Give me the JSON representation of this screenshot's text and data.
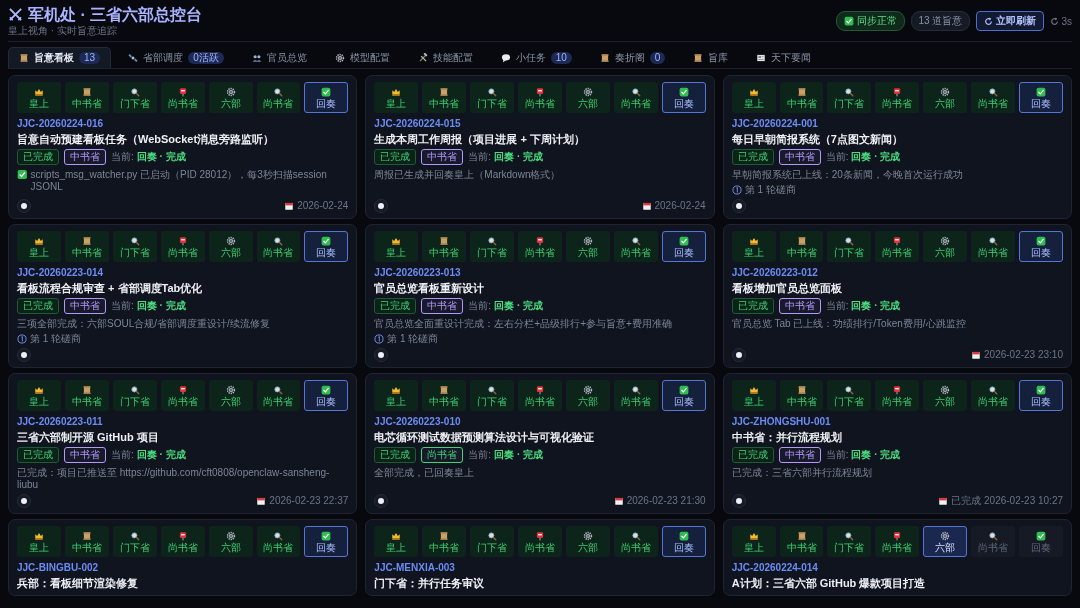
{
  "header": {
    "title": "军机处 · 三省六部总控台",
    "subtitle": "皇上视角 · 实时旨意追踪",
    "sync": "同步正常",
    "count": "13 道旨意",
    "refresh": "立即刷新",
    "interval": "3s"
  },
  "tabs": [
    {
      "label": "旨意看板",
      "count": "13",
      "selected": true
    },
    {
      "label": "省部调度",
      "count": "0活跃",
      "selected": false
    },
    {
      "label": "官员总览",
      "selected": false
    },
    {
      "label": "模型配置",
      "selected": false
    },
    {
      "label": "技能配置",
      "selected": false
    },
    {
      "label": "小任务",
      "count": "10",
      "selected": false
    },
    {
      "label": "奏折阁",
      "count": "0",
      "selected": false
    },
    {
      "label": "旨库",
      "selected": false
    },
    {
      "label": "天下要闻",
      "selected": false
    }
  ],
  "cards": [
    {
      "stages": [
        {
          "label": "皇上",
          "done": true,
          "selected": false
        },
        {
          "label": "中书省",
          "done": true,
          "selected": false
        },
        {
          "label": "门下省",
          "done": true,
          "selected": false
        },
        {
          "label": "尚书省",
          "done": true,
          "selected": false
        },
        {
          "label": "六部",
          "done": true,
          "selected": false
        },
        {
          "label": "尚书省",
          "done": true,
          "selected": false
        },
        {
          "label": "回奏",
          "done": true,
          "selected": true
        }
      ],
      "id": "JJC-20260224-016",
      "title": "旨意自动预建看板任务（WebSocket消息旁路监听）",
      "status": "已完成",
      "dept": "中书省",
      "color": "#b597ff",
      "current_label": "当前:",
      "current": "回奏 · 完成",
      "note": "scripts_msg_watcher.py 已启动（PID 28012），每3秒扫描session JSONL",
      "note_check": true,
      "date": "2026-02-24"
    },
    {
      "stages": [
        {
          "label": "皇上",
          "done": true,
          "selected": false
        },
        {
          "label": "中书省",
          "done": true,
          "selected": false
        },
        {
          "label": "门下省",
          "done": true,
          "selected": false
        },
        {
          "label": "尚书省",
          "done": true,
          "selected": false
        },
        {
          "label": "六部",
          "done": true,
          "selected": false
        },
        {
          "label": "尚书省",
          "done": true,
          "selected": false
        },
        {
          "label": "回奏",
          "done": true,
          "selected": true
        }
      ],
      "id": "JJC-20260224-015",
      "title": "生成本周工作周报（项目进展 + 下周计划）",
      "status": "已完成",
      "dept": "中书省",
      "color": "#b597ff",
      "current_label": "当前:",
      "current": "回奏 · 完成",
      "note": "周报已生成并回奏皇上（Markdown格式）",
      "date": "2026-02-24"
    },
    {
      "stages": [
        {
          "label": "皇上",
          "done": true,
          "selected": false
        },
        {
          "label": "中书省",
          "done": true,
          "selected": false
        },
        {
          "label": "门下省",
          "done": true,
          "selected": false
        },
        {
          "label": "尚书省",
          "done": true,
          "selected": false
        },
        {
          "label": "六部",
          "done": true,
          "selected": false
        },
        {
          "label": "尚书省",
          "done": true,
          "selected": false
        },
        {
          "label": "回奏",
          "done": true,
          "selected": true
        }
      ],
      "id": "JJC-20260224-001",
      "title": "每日早朝简报系统（7点图文新闻）",
      "status": "已完成",
      "dept": "中书省",
      "color": "#b597ff",
      "current_label": "当前:",
      "current": "回奏 · 完成",
      "note": "早朝简报系统已上线：20条新闻，今晚首次运行成功",
      "round": "第 1 轮磋商"
    },
    {
      "stages": [
        {
          "label": "皇上",
          "done": true,
          "selected": false
        },
        {
          "label": "中书省",
          "done": true,
          "selected": false
        },
        {
          "label": "门下省",
          "done": true,
          "selected": false
        },
        {
          "label": "尚书省",
          "done": true,
          "selected": false
        },
        {
          "label": "六部",
          "done": true,
          "selected": false
        },
        {
          "label": "尚书省",
          "done": true,
          "selected": false
        },
        {
          "label": "回奏",
          "done": true,
          "selected": true
        }
      ],
      "id": "JJC-20260223-014",
      "title": "看板流程合规审查 + 省部调度Tab优化",
      "status": "已完成",
      "dept": "中书省",
      "color": "#b597ff",
      "current_label": "当前:",
      "current": "回奏 · 完成",
      "note": "三项全部完成：六部SOUL合规/省部调度重设计/续流修复",
      "round": "第 1 轮磋商"
    },
    {
      "stages": [
        {
          "label": "皇上",
          "done": true,
          "selected": false
        },
        {
          "label": "中书省",
          "done": true,
          "selected": false
        },
        {
          "label": "门下省",
          "done": true,
          "selected": false
        },
        {
          "label": "尚书省",
          "done": true,
          "selected": false
        },
        {
          "label": "六部",
          "done": true,
          "selected": false
        },
        {
          "label": "尚书省",
          "done": true,
          "selected": false
        },
        {
          "label": "回奏",
          "done": true,
          "selected": true
        }
      ],
      "id": "JJC-20260223-013",
      "title": "官员总览看板重新设计",
      "status": "已完成",
      "dept": "中书省",
      "color": "#b597ff",
      "current_label": "当前:",
      "current": "回奏 · 完成",
      "note": "官员总览全面重设计完成：左右分栏+品级排行+参与旨意+费用准确",
      "round": "第 1 轮磋商"
    },
    {
      "stages": [
        {
          "label": "皇上",
          "done": true,
          "selected": false
        },
        {
          "label": "中书省",
          "done": true,
          "selected": false
        },
        {
          "label": "门下省",
          "done": true,
          "selected": false
        },
        {
          "label": "尚书省",
          "done": true,
          "selected": false
        },
        {
          "label": "六部",
          "done": true,
          "selected": false
        },
        {
          "label": "尚书省",
          "done": true,
          "selected": false
        },
        {
          "label": "回奏",
          "done": true,
          "selected": true
        }
      ],
      "id": "JJC-20260223-012",
      "title": "看板增加官员总览面板",
      "status": "已完成",
      "dept": "中书省",
      "color": "#b597ff",
      "current_label": "当前:",
      "current": "回奏 · 完成",
      "note": "官员总览 Tab 已上线：功绩排行/Token费用/心跳监控",
      "date": "2026-02-23 23:10"
    },
    {
      "stages": [
        {
          "label": "皇上",
          "done": true,
          "selected": false
        },
        {
          "label": "中书省",
          "done": true,
          "selected": false
        },
        {
          "label": "门下省",
          "done": true,
          "selected": false
        },
        {
          "label": "尚书省",
          "done": true,
          "selected": false
        },
        {
          "label": "六部",
          "done": true,
          "selected": false
        },
        {
          "label": "尚书省",
          "done": true,
          "selected": false
        },
        {
          "label": "回奏",
          "done": true,
          "selected": true
        }
      ],
      "id": "JJC-20260223-011",
      "title": "三省六部制开源 GitHub 项目",
      "status": "已完成",
      "dept": "中书省",
      "color": "#b597ff",
      "current_label": "当前:",
      "current": "回奏 · 完成",
      "note": "已完成：项目已推送至 https://github.com/cft0808/openclaw-sansheng-liubu",
      "date": "2026-02-23 22:37"
    },
    {
      "stages": [
        {
          "label": "皇上",
          "done": true,
          "selected": false
        },
        {
          "label": "中书省",
          "done": true,
          "selected": false
        },
        {
          "label": "门下省",
          "done": true,
          "selected": false
        },
        {
          "label": "尚书省",
          "done": true,
          "selected": false
        },
        {
          "label": "六部",
          "done": true,
          "selected": false
        },
        {
          "label": "尚书省",
          "done": true,
          "selected": false
        },
        {
          "label": "回奏",
          "done": true,
          "selected": true
        }
      ],
      "id": "JJC-20260223-010",
      "title": "电芯循环测试数据预测算法设计与可视化验证",
      "status": "已完成",
      "dept": "尚书省",
      "color": "#43d27a",
      "current_label": "当前:",
      "current": "回奏 · 完成",
      "note": "全部完成，已回奏皇上",
      "date": "2026-02-23 21:30"
    },
    {
      "stages": [
        {
          "label": "皇上",
          "done": true,
          "selected": false
        },
        {
          "label": "中书省",
          "done": true,
          "selected": false
        },
        {
          "label": "门下省",
          "done": true,
          "selected": false
        },
        {
          "label": "尚书省",
          "done": true,
          "selected": false
        },
        {
          "label": "六部",
          "done": true,
          "selected": false
        },
        {
          "label": "尚书省",
          "done": true,
          "selected": false
        },
        {
          "label": "回奏",
          "done": true,
          "selected": true
        }
      ],
      "id": "JJC-ZHONGSHU-001",
      "title": "中书省：并行流程规划",
      "status": "已完成",
      "dept": "中书省",
      "color": "#b597ff",
      "current_label": "当前:",
      "current": "回奏 · 完成",
      "note": "已完成：三省六部并行流程规划",
      "date": "已完成 2026-02-23 10:27"
    },
    {
      "stages": [
        {
          "label": "皇上",
          "done": true,
          "selected": false
        },
        {
          "label": "中书省",
          "done": true,
          "selected": false
        },
        {
          "label": "门下省",
          "done": true,
          "selected": false
        },
        {
          "label": "尚书省",
          "done": true,
          "selected": false
        },
        {
          "label": "六部",
          "done": true,
          "selected": false
        },
        {
          "label": "尚书省",
          "done": true,
          "selected": false
        },
        {
          "label": "回奏",
          "done": true,
          "selected": true
        }
      ],
      "id": "JJC-BINGBU-002",
      "title": "兵部：看板细节渲染修复"
    },
    {
      "stages": [
        {
          "label": "皇上",
          "done": true,
          "selected": false
        },
        {
          "label": "中书省",
          "done": true,
          "selected": false
        },
        {
          "label": "门下省",
          "done": true,
          "selected": false
        },
        {
          "label": "尚书省",
          "done": true,
          "selected": false
        },
        {
          "label": "六部",
          "done": true,
          "selected": false
        },
        {
          "label": "尚书省",
          "done": true,
          "selected": false
        },
        {
          "label": "回奏",
          "done": true,
          "selected": true
        }
      ],
      "id": "JJC-MENXIA-003",
      "title": "门下省：并行任务审议"
    },
    {
      "stages": [
        {
          "label": "皇上",
          "done": true,
          "selected": false
        },
        {
          "label": "中书省",
          "done": true,
          "selected": false
        },
        {
          "label": "门下省",
          "done": true,
          "selected": false
        },
        {
          "label": "尚书省",
          "done": true,
          "selected": false
        },
        {
          "label": "六部",
          "done": false,
          "selected": true
        },
        {
          "label": "尚书省",
          "done": false,
          "selected": false
        },
        {
          "label": "回奏",
          "done": false,
          "selected": false
        }
      ],
      "id": "JJC-20260224-014",
      "title": "A计划：三省六部 GitHub 爆款项目打造"
    }
  ]
}
